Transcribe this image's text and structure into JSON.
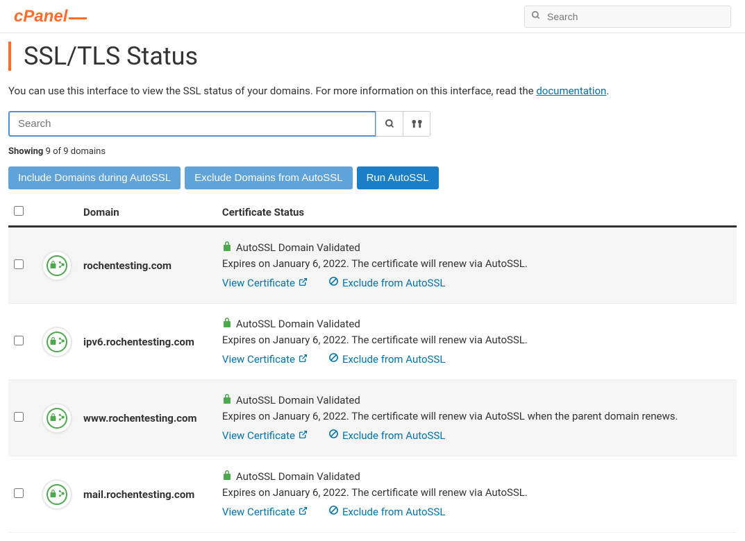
{
  "header": {
    "search_placeholder": "Search"
  },
  "page": {
    "title": "SSL/TLS Status",
    "intro_text": "You can use this interface to view the SSL status of your domains. For more information on this interface, read the ",
    "doc_link": "documentation",
    "intro_suffix": "."
  },
  "filter": {
    "search_placeholder": "Search",
    "showing_label": "Showing",
    "showing_count": "9 of 9 domains"
  },
  "buttons": {
    "include": "Include Domains during AutoSSL",
    "exclude": "Exclude Domains from AutoSSL",
    "run": "Run AutoSSL"
  },
  "table": {
    "headers": {
      "domain": "Domain",
      "cert_status": "Certificate Status"
    },
    "status_validated": "AutoSSL Domain Validated",
    "view_cert": "View Certificate",
    "exclude_link": "Exclude from AutoSSL",
    "rows": [
      {
        "domain": "rochentesting.com",
        "expiry": "Expires on January 6, 2022. The certificate will renew via AutoSSL."
      },
      {
        "domain": "ipv6.rochentesting.com",
        "expiry": "Expires on January 6, 2022. The certificate will renew via AutoSSL."
      },
      {
        "domain": "www.rochentesting.com",
        "expiry": "Expires on January 6, 2022. The certificate will renew via AutoSSL when the parent domain renews."
      },
      {
        "domain": "mail.rochentesting.com",
        "expiry": "Expires on January 6, 2022. The certificate will renew via AutoSSL."
      }
    ]
  }
}
